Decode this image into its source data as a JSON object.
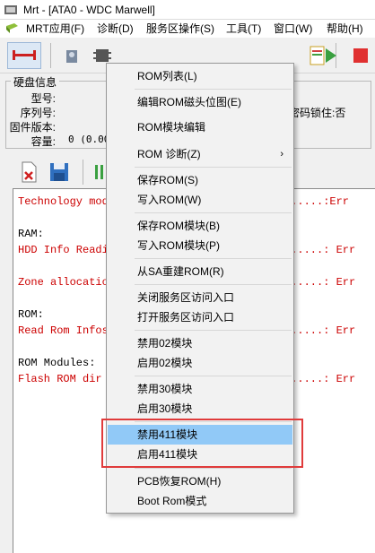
{
  "window": {
    "title": "Mrt - [ATA0 - WDC Marwell]"
  },
  "menubar": {
    "items": [
      {
        "label": "MRT应用(F)"
      },
      {
        "label": "诊断(D)"
      },
      {
        "label": "服务区操作(S)"
      },
      {
        "label": "工具(T)"
      },
      {
        "label": "窗口(W)"
      },
      {
        "label": "帮助(H)"
      }
    ]
  },
  "drive_info": {
    "title": "硬盘信息",
    "model_label": "型号:",
    "serial_label": "序列号:",
    "firmware_label": "固件版本:",
    "capacity_label": "容量:",
    "capacity_value": "0 (0.00",
    "password_lock": "密码锁住:否"
  },
  "log": {
    "lines": [
      {
        "text": "Technology mod",
        "err": "......:Err",
        "red": true
      },
      {
        "text": "RAM:",
        "err": "",
        "red": false
      },
      {
        "text": "HDD Info Readi",
        "err": "......: Err",
        "red": true
      },
      {
        "text": "Zone allocatio",
        "err": "......: Err",
        "red": true
      },
      {
        "text": "ROM:",
        "err": "",
        "red": false
      },
      {
        "text": "Read Rom Infos",
        "err": "......: Err",
        "red": true
      },
      {
        "text": "ROM Modules:",
        "err": "",
        "red": false
      },
      {
        "text": "Flash ROM dir",
        "err": "......: Err",
        "red": true
      }
    ]
  },
  "popup_menu": {
    "items": [
      {
        "label": "ROM列表(L)"
      },
      {
        "label": "编辑ROM磁头位图(E)"
      },
      {
        "label": "ROM模块编辑"
      },
      {
        "label": "ROM 诊断(Z)",
        "submenu_arrow": "›"
      },
      {
        "label": "保存ROM(S)"
      },
      {
        "label": "写入ROM(W)"
      },
      {
        "label": "保存ROM模块(B)"
      },
      {
        "label": "写入ROM模块(P)"
      },
      {
        "label": "从SA重建ROM(R)"
      },
      {
        "label": "关闭服务区访问入口"
      },
      {
        "label": "打开服务区访问入口"
      },
      {
        "label": "禁用02模块"
      },
      {
        "label": "启用02模块"
      },
      {
        "label": "禁用30模块"
      },
      {
        "label": "启用30模块"
      },
      {
        "label": "禁用411模块",
        "highlighted": true
      },
      {
        "label": "启用411模块"
      },
      {
        "label": "PCB恢复ROM(H)"
      },
      {
        "label": "Boot Rom模式"
      }
    ]
  },
  "colors": {
    "highlight_box": "#e03b3b",
    "menu_highlight": "#91c9f7",
    "log_error": "#cc0000"
  }
}
